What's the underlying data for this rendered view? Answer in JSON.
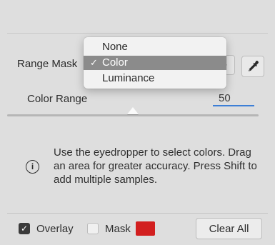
{
  "range_mask": {
    "label": "Range Mask",
    "chevron": "⌄",
    "dropdown": {
      "options": [
        "None",
        "Color",
        "Luminance"
      ],
      "selected": "Color",
      "check": "✓"
    },
    "eyedropper_icon": "eyedropper-icon"
  },
  "color_range": {
    "label": "Color Range",
    "value": "50",
    "slider_fraction": 0.5
  },
  "info": {
    "icon_glyph": "i",
    "text": "Use the eyedropper to select colors. Drag an area for greater accuracy. Press Shift to add multiple samples."
  },
  "footer": {
    "overlay": {
      "label": "Overlay",
      "checked": true,
      "check": "✓"
    },
    "mask": {
      "label": "Mask",
      "checked": false,
      "color": "#d21f1f"
    },
    "clear_all_label": "Clear All"
  },
  "colors": {
    "accent": "#3d7fd6",
    "selected_bg": "#8b8b8b"
  }
}
